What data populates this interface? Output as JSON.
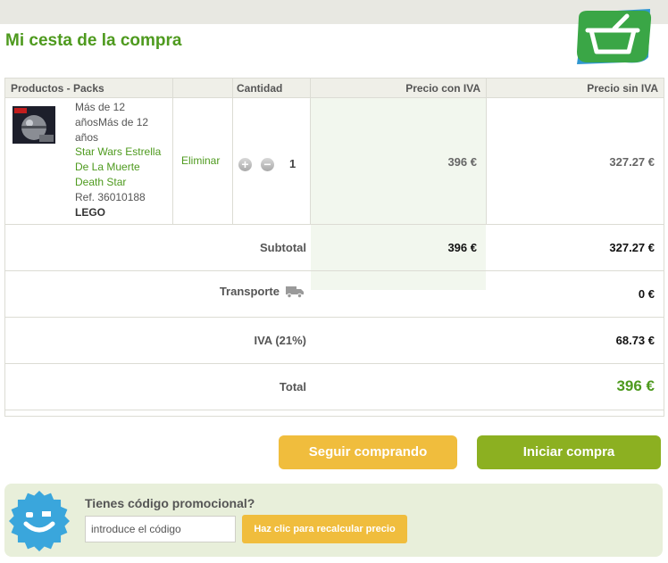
{
  "page": {
    "title": "Mi cesta de la compra"
  },
  "icons": {
    "logo": "shopping-basket-icon",
    "transport": "truck-icon",
    "promo": "smiley-badge-icon"
  },
  "colors": {
    "green": "#4e9a1e",
    "yellow": "#f0bd3d",
    "olive": "#8cb021",
    "badge_blue": "#3aa6dc"
  },
  "table": {
    "headers": {
      "products": "Productos - Packs",
      "quantity": "Cantidad",
      "price_with_vat": "Precio con IVA",
      "price_without_vat": "Precio sin IVA"
    },
    "items": [
      {
        "age": "Más de 12 añosMás de 12 años",
        "name": "Star Wars Estrella De La Muerte Death Star",
        "ref": "Ref. 36010188",
        "brand": "LEGO",
        "remove_label": "Eliminar",
        "quantity": "1",
        "price_with_vat": "396 €",
        "price_without_vat": "327.27 €"
      }
    ]
  },
  "summary": {
    "subtotal": {
      "label": "Subtotal",
      "with_vat": "396 €",
      "without_vat": "327.27 €"
    },
    "transport": {
      "label": "Transporte",
      "value": "0 €"
    },
    "vat": {
      "label": "IVA (21%)",
      "value": "68.73 €"
    },
    "total": {
      "label": "Total",
      "value": "396 €"
    }
  },
  "actions": {
    "continue_label": "Seguir comprando",
    "checkout_label": "Iniciar compra"
  },
  "promo": {
    "title": "Tienes código promocional?",
    "placeholder": "introduce el código",
    "button_label": "Haz clic para recalcular precio"
  }
}
